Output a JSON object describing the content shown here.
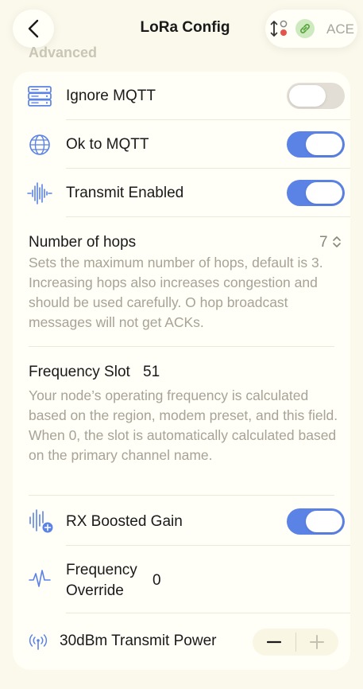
{
  "nav": {
    "title": "LoRa Config",
    "status_label": "ACE"
  },
  "section": {
    "header": "Advanced"
  },
  "rows": {
    "ignore_mqtt": {
      "label": "Ignore MQTT",
      "enabled": false,
      "icon": "server-icon"
    },
    "ok_to_mqtt": {
      "label": "Ok to MQTT",
      "enabled": true,
      "icon": "globe-icon"
    },
    "transmit_enabled": {
      "label": "Transmit Enabled",
      "enabled": true,
      "icon": "waveform-icon"
    },
    "hops": {
      "label": "Number of hops",
      "value": "7",
      "description": "Sets the maximum number of hops, default is 3. Increasing hops also increases congestion and should be used carefully. O hop broadcast messages will not get ACKs."
    },
    "frequency_slot": {
      "label": "Frequency Slot",
      "value": "51",
      "description": "Your node’s operating frequency is calculated based on the region, modem preset, and this field. When 0, the slot is automatically calculated based on the primary channel name."
    },
    "rx_boosted_gain": {
      "label": "RX Boosted Gain",
      "enabled": true,
      "icon": "boosted-waveform-icon"
    },
    "frequency_override": {
      "label_line1": "Frequency",
      "label_line2": "Override",
      "value": "0",
      "icon": "pulse-icon"
    },
    "transmit_power": {
      "label": "30dBm Transmit Power",
      "icon": "antenna-icon"
    }
  },
  "colors": {
    "accent": "#5b83e6",
    "background": "#fbf9ec",
    "card": "#fffef7",
    "secondary_text": "#a7a396"
  }
}
